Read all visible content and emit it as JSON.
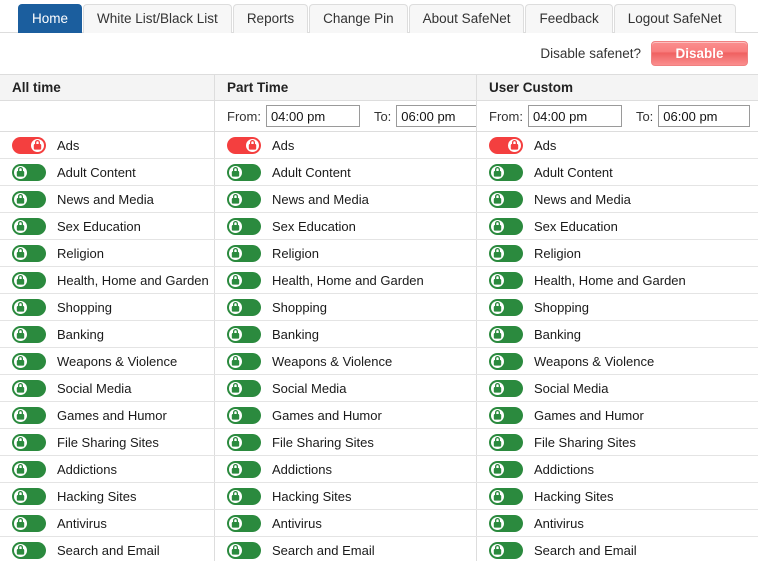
{
  "tabs": [
    {
      "label": "Home",
      "active": true
    },
    {
      "label": "White List/Black List",
      "active": false
    },
    {
      "label": "Reports",
      "active": false
    },
    {
      "label": "Change Pin",
      "active": false
    },
    {
      "label": "About SafeNet",
      "active": false
    },
    {
      "label": "Feedback",
      "active": false
    },
    {
      "label": "Logout SafeNet",
      "active": false
    }
  ],
  "disable_bar": {
    "question": "Disable safenet?",
    "button_label": "Disable"
  },
  "columns": [
    {
      "title": "All time",
      "has_time": false
    },
    {
      "title": "Part Time",
      "has_time": true,
      "from_label": "From:",
      "from_value": "04:00 pm",
      "to_label": "To:",
      "to_value": "06:00 pm"
    },
    {
      "title": "User Custom",
      "has_time": true,
      "from_label": "From:",
      "from_value": "04:00 pm",
      "to_label": "To:",
      "to_value": "06:00 pm"
    }
  ],
  "categories": [
    {
      "label": "Ads",
      "state": "on"
    },
    {
      "label": "Adult Content",
      "state": "off"
    },
    {
      "label": "News and Media",
      "state": "off"
    },
    {
      "label": "Sex Education",
      "state": "off"
    },
    {
      "label": "Religion",
      "state": "off"
    },
    {
      "label": "Health, Home and Garden",
      "state": "off"
    },
    {
      "label": "Shopping",
      "state": "off"
    },
    {
      "label": "Banking",
      "state": "off"
    },
    {
      "label": "Weapons & Violence",
      "state": "off"
    },
    {
      "label": "Social Media",
      "state": "off"
    },
    {
      "label": "Games and Humor",
      "state": "off"
    },
    {
      "label": "File Sharing Sites",
      "state": "off"
    },
    {
      "label": "Addictions",
      "state": "off"
    },
    {
      "label": "Hacking Sites",
      "state": "off"
    },
    {
      "label": "Antivirus",
      "state": "off"
    },
    {
      "label": "Search and Email",
      "state": "off"
    }
  ],
  "icons": {
    "toggle_on": "lock-closed-icon",
    "toggle_off": "lock-closed-icon"
  },
  "colors": {
    "tab_active_bg": "#1b5e9e",
    "toggle_on": "#f43f3f",
    "toggle_off": "#2b8a3e",
    "disable_button": "#f97d7d",
    "header_bg": "#f4f4f4"
  }
}
